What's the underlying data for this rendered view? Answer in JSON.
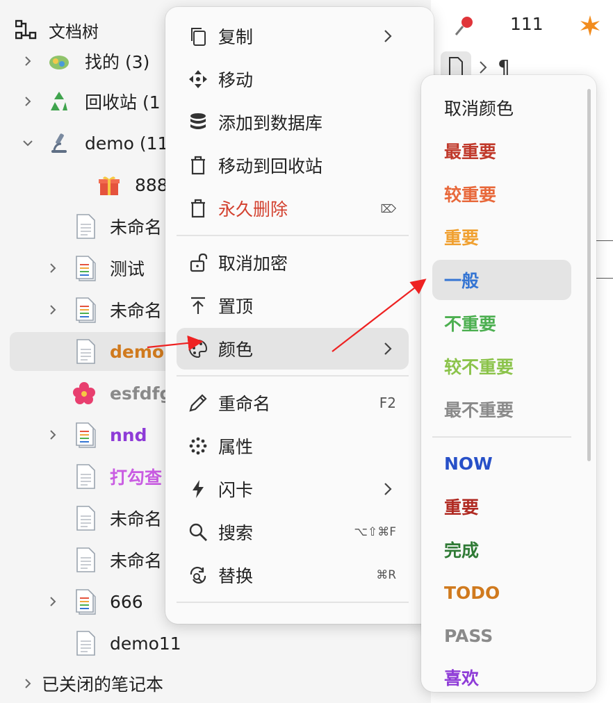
{
  "tree": {
    "header": "文档树",
    "rows": [
      {
        "label": "找的 (3)",
        "color": "#1f1f1f"
      },
      {
        "label": "回收站 (1",
        "color": "#1f1f1f"
      },
      {
        "label": "demo (11",
        "color": "#1f1f1f"
      },
      {
        "label": "888",
        "color": "#1f1f1f"
      },
      {
        "label": "未命名",
        "color": "#1f1f1f"
      },
      {
        "label": "测试",
        "color": "#1f1f1f"
      },
      {
        "label": "未命名",
        "color": "#1f1f1f"
      },
      {
        "label": "demo",
        "color": "#d07a1e"
      },
      {
        "label": "esfdfg",
        "color": "#8a8a8a"
      },
      {
        "label": "nnd",
        "color": "#8e3bd7"
      },
      {
        "label": "打勾查",
        "color": "#c95ce2"
      },
      {
        "label": "未命名",
        "color": "#1f1f1f"
      },
      {
        "label": "未命名",
        "color": "#1f1f1f"
      },
      {
        "label": "666",
        "color": "#1f1f1f"
      },
      {
        "label": "demo11",
        "color": "#1f1f1f"
      },
      {
        "label": "已关闭的笔记本",
        "color": "#1f1f1f"
      }
    ]
  },
  "editor": {
    "count": "111"
  },
  "menu": {
    "items": [
      {
        "label": "复制",
        "icon": "copy-icon"
      },
      {
        "label": "移动",
        "icon": "move-icon"
      },
      {
        "label": "添加到数据库",
        "icon": "database-icon"
      },
      {
        "label": "移动到回收站",
        "icon": "trash-icon"
      },
      {
        "label": "永久删除",
        "icon": "trash-icon",
        "key": "⌦"
      },
      {
        "label": "取消加密",
        "icon": "unlock-icon"
      },
      {
        "label": "置顶",
        "icon": "pin-top-icon"
      },
      {
        "label": "颜色",
        "icon": "palette-icon"
      },
      {
        "label": "重命名",
        "icon": "pencil-icon",
        "key": "F2"
      },
      {
        "label": "属性",
        "icon": "attributes-icon"
      },
      {
        "label": "闪卡",
        "icon": "flash-icon"
      },
      {
        "label": "搜索",
        "icon": "search-icon",
        "key": "⌥⇧⌘F"
      },
      {
        "label": "替换",
        "icon": "replace-icon",
        "key": "⌘R"
      }
    ]
  },
  "colors": {
    "items": [
      {
        "label": "取消颜色",
        "color": "#222222"
      },
      {
        "label": "最重要",
        "color": "#c0392b"
      },
      {
        "label": "较重要",
        "color": "#e8683a"
      },
      {
        "label": "重要",
        "color": "#f0a030"
      },
      {
        "label": "一般",
        "color": "#3575d3"
      },
      {
        "label": "不重要",
        "color": "#4caf50"
      },
      {
        "label": "较不重要",
        "color": "#8bc34a"
      },
      {
        "label": "最不重要",
        "color": "#8a8a8a"
      },
      {
        "label": "NOW",
        "color": "#2750c8"
      },
      {
        "label": "重要",
        "color": "#b02a22"
      },
      {
        "label": "完成",
        "color": "#2f7a35"
      },
      {
        "label": "TODO",
        "color": "#d07a1e"
      },
      {
        "label": "PASS",
        "color": "#8a8a8a"
      },
      {
        "label": "喜欢",
        "color": "#8e3bd7"
      }
    ]
  }
}
